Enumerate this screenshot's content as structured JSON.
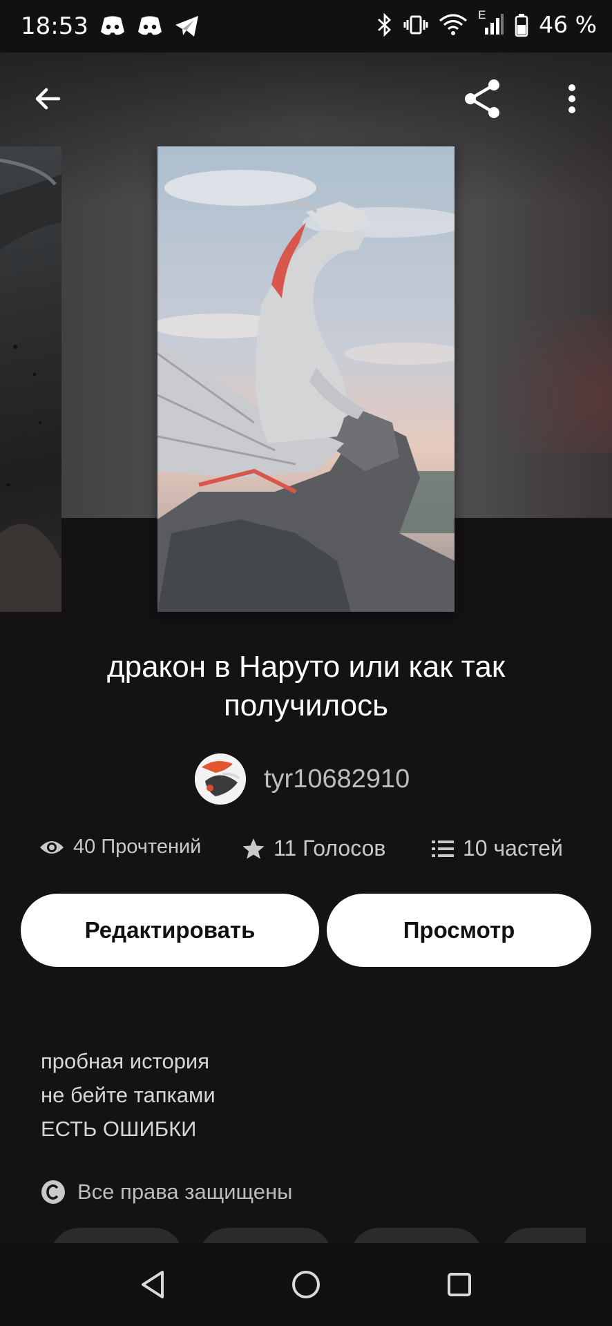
{
  "status_bar": {
    "time": "18:53",
    "network_label": "E",
    "battery": "46 %"
  },
  "toolbar": {
    "back_icon": "arrow-left-icon",
    "share_icon": "share-icon",
    "more_icon": "more-vertical-icon"
  },
  "story": {
    "title": "дракон в Наруто или как так получилось",
    "author": "tyr10682910",
    "stats": {
      "reads": "40 Прочтений",
      "votes": "11 Голосов",
      "parts": "10 частей"
    },
    "buttons": {
      "edit": "Редактировать",
      "preview": "Просмотр"
    },
    "description": [
      "пробная история",
      "не бейте тапками",
      "ЕСТЬ ОШИБКИ"
    ],
    "copyright": "Все права защищены"
  },
  "colors": {
    "background": "#141215",
    "button_bg": "#ffffff",
    "text_secondary": "#c9c9c9"
  }
}
